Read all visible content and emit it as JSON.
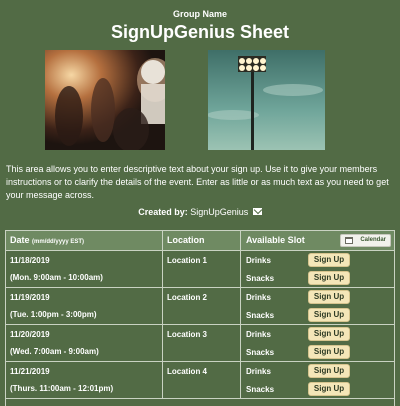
{
  "header": {
    "group_name": "Group Name",
    "title": "SignUpGenius Sheet"
  },
  "images": [
    {
      "icon": "football-players-photo"
    },
    {
      "icon": "stadium-lights-photo"
    }
  ],
  "description": "This area allows you to enter descriptive text about your sign up. Use it to give your members instructions or to clarify the details of the event. Enter as little or as much text as you need to get your message across.",
  "created_by": {
    "label": "Created by:",
    "name": "SignUpGenius",
    "icon": "envelope-icon"
  },
  "table": {
    "headers": {
      "date": "Date",
      "date_format": "(mm/dd/yyyy EST)",
      "location": "Location",
      "slot": "Available Slot",
      "calendar": "Calendar"
    },
    "rows": [
      {
        "date": "11/18/2019",
        "time": "(Mon. 9:00am - 10:00am)",
        "location": "Location 1",
        "slots": [
          {
            "name": "Drinks",
            "button": "Sign Up"
          },
          {
            "name": "Snacks",
            "button": "Sign Up"
          }
        ]
      },
      {
        "date": "11/19/2019",
        "time": "(Tue. 1:00pm - 3:00pm)",
        "location": "Location 2",
        "slots": [
          {
            "name": "Drinks",
            "button": "Sign Up"
          },
          {
            "name": "Snacks",
            "button": "Sign Up"
          }
        ]
      },
      {
        "date": "11/20/2019",
        "time": "(Wed. 7:00am - 9:00am)",
        "location": "Location 3",
        "slots": [
          {
            "name": "Drinks",
            "button": "Sign Up"
          },
          {
            "name": "Snacks",
            "button": "Sign Up"
          }
        ]
      },
      {
        "date": "11/21/2019",
        "time": "(Thurs. 11:00am - 12:01pm)",
        "location": "Location 4",
        "slots": [
          {
            "name": "Drinks",
            "button": "Sign Up"
          },
          {
            "name": "Snacks",
            "button": "Sign Up"
          }
        ]
      }
    ]
  },
  "colors": {
    "background": "#526b45",
    "header_row": "#6f8a62",
    "button": "#f4e6b8"
  }
}
